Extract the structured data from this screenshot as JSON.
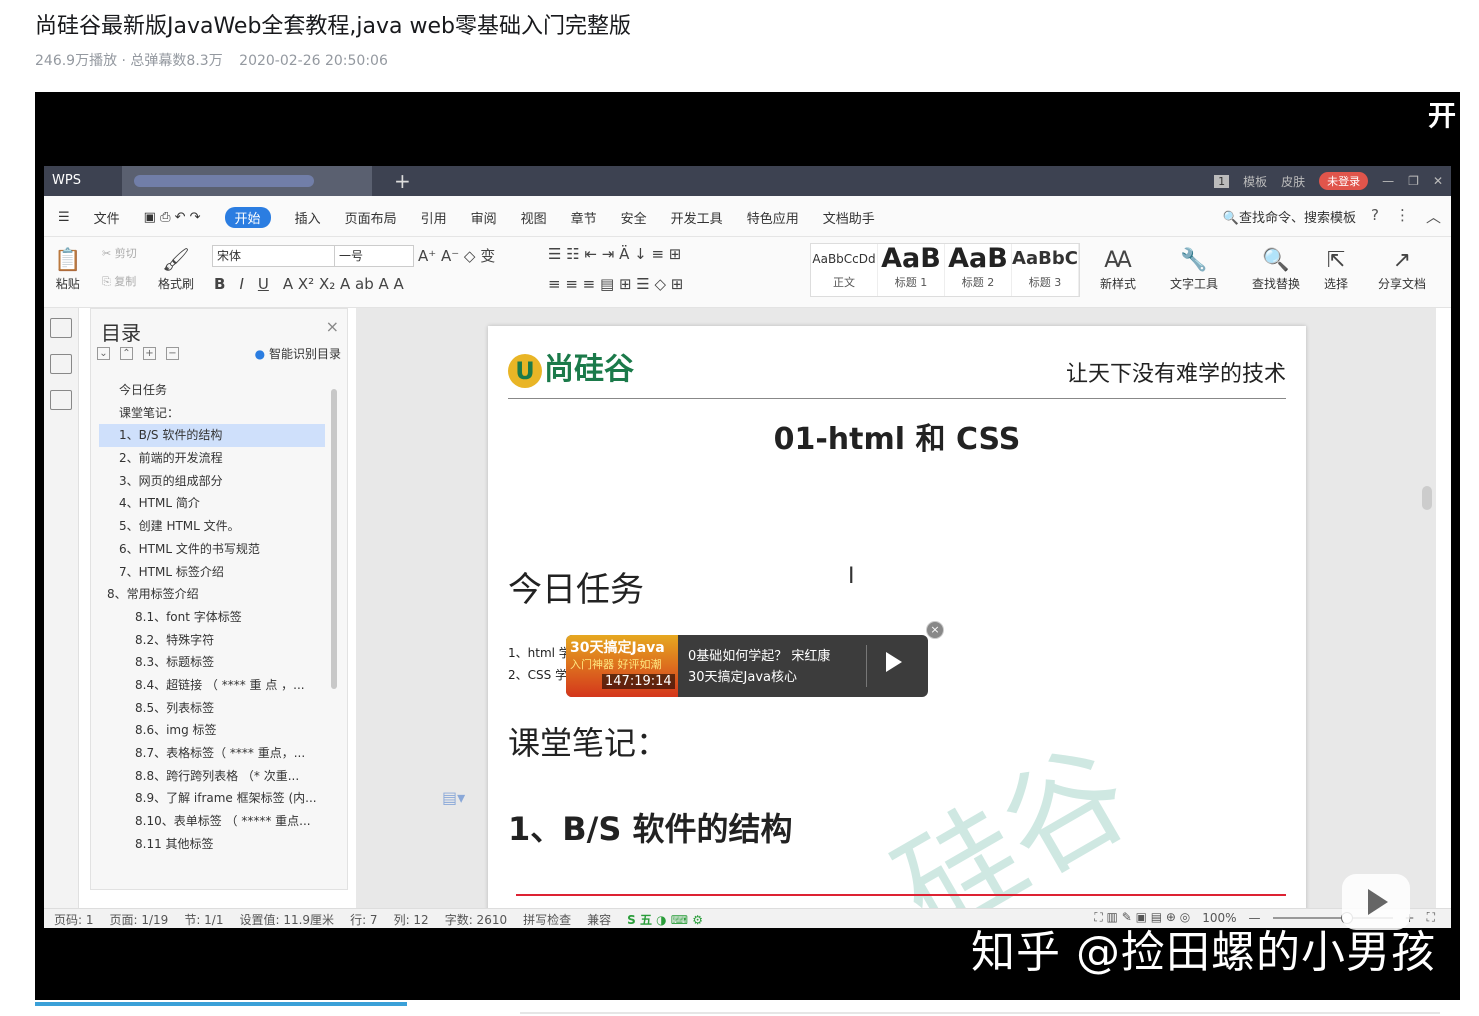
{
  "page": {
    "title": "尚硅谷最新版JavaWeb全套教程,java web零基础入门完整版",
    "meta": [
      "246.9万播放 · 总弹幕数8.3万",
      "2020-02-26 20:50:06"
    ]
  },
  "player": {
    "top_overlay": "开",
    "watermark": "知乎 @捡田螺的小男孩"
  },
  "wps": {
    "app_name": "WPS",
    "titlebar": {
      "page_num": "1",
      "template": "模板",
      "skin": "皮肤",
      "login": "未登录"
    },
    "menu": [
      "文件",
      "开始",
      "插入",
      "页面布局",
      "引用",
      "审阅",
      "视图",
      "章节",
      "安全",
      "开发工具",
      "特色应用",
      "文档助手"
    ],
    "search": "查找命令、搜索模板",
    "ribbon": {
      "paste": "粘贴",
      "cut": "剪切",
      "copy": "复制",
      "format_painter": "格式刷",
      "font": "宋体",
      "size": "一号",
      "styles": [
        {
          "sample": "AaBbCcDd",
          "label": "正文"
        },
        {
          "sample": "AaB",
          "label": "标题 1"
        },
        {
          "sample": "AaB",
          "label": "标题 2"
        },
        {
          "sample": "AaBbC",
          "label": "标题 3"
        }
      ],
      "new_style": "新样式",
      "text_tool": "文字工具",
      "find_replace": "查找替换",
      "select": "选择",
      "share": "分享文档"
    },
    "toc": {
      "title": "目录",
      "smart": "智能识别目录",
      "items": [
        "今日任务",
        "课堂笔记：",
        "1、B/S 软件的结构",
        "2、前端的开发流程",
        "3、网页的组成部分",
        "4、HTML 简介",
        "5、创建 HTML 文件。",
        "6、HTML 文件的书写规范",
        "7、HTML 标签介绍",
        "8、常用标签介绍",
        "8.1、font 字体标签",
        "8.2、特殊字符",
        "8.3、标题标签",
        "8.4、超链接 （ **** 重 点 ，...",
        "8.5、列表标签",
        "8.6、img 标签",
        "8.7、表格标签（ **** 重点，...",
        "8.8、跨行跨列表格 （* 次重...",
        "8.9、了解 iframe 框架标签 (内...",
        "8.10、表单标签 （ ***** 重点...",
        "8.11 其他标签"
      ]
    },
    "doc": {
      "logo": "尚硅谷",
      "logo_mark": "U",
      "slogan": "让天下没有难学的技术",
      "h1": "01-html 和 CSS",
      "section1": "今日任务",
      "list": [
        "1、html 学",
        "2、CSS 学"
      ],
      "section2": "课堂笔记：",
      "section3": "1、B/S  软件的结构",
      "watermark": "硅谷"
    },
    "status": {
      "items": [
        "页码: 1",
        "页面: 1/19",
        "节: 1/1",
        "设置值: 11.9厘米",
        "行: 7",
        "列: 12",
        "字数: 2610",
        "拼写检查",
        "兼容"
      ],
      "zoom": "100%"
    }
  },
  "ad": {
    "thumb_title": "30天搞定Java",
    "thumb_sub": "入门神器 好评如潮",
    "duration": "147:19:14",
    "line1": "0基础如何学起？ 宋红康",
    "line2": "30天搞定Java核心"
  }
}
